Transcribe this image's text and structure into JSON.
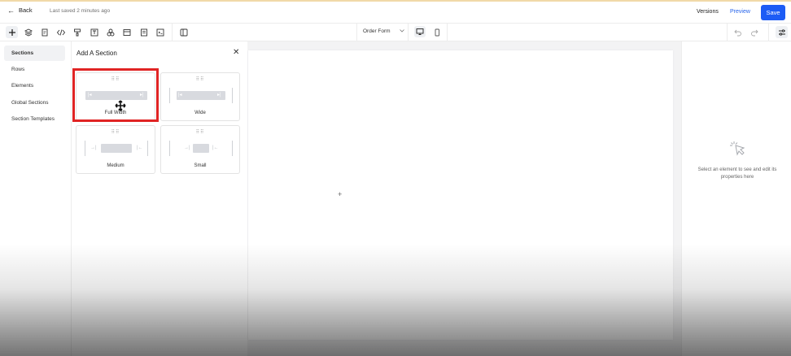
{
  "header": {
    "back_label": "Back",
    "saved_status": "Last saved 2 minutes ago",
    "versions_label": "Versions",
    "preview_label": "Preview",
    "save_label": "Save"
  },
  "toolbar": {
    "form_select": {
      "value": "Order Form",
      "icon": "chevron-down-icon"
    },
    "tools": [
      "add-icon",
      "layers-icon",
      "pages-icon",
      "code-icon",
      "paint-icon",
      "text-icon",
      "shapes-icon",
      "section-icon",
      "form-icon",
      "terminal-icon",
      "columns-icon"
    ]
  },
  "leftnav": {
    "items": [
      {
        "label": "Sections",
        "active": true
      },
      {
        "label": "Rows"
      },
      {
        "label": "Elements"
      },
      {
        "label": "Global Sections"
      },
      {
        "label": "Section Templates"
      }
    ]
  },
  "panel": {
    "title": "Add A Section",
    "cards": [
      {
        "label": "Full Width"
      },
      {
        "label": "Wide"
      },
      {
        "label": "Medium"
      },
      {
        "label": "Small"
      }
    ]
  },
  "canvas": {
    "add_symbol": "+"
  },
  "rightpanel": {
    "empty_message": "Select an element to see and edit its properties here"
  },
  "colors": {
    "accent": "#1d5cf5",
    "highlight": "#e02424"
  }
}
